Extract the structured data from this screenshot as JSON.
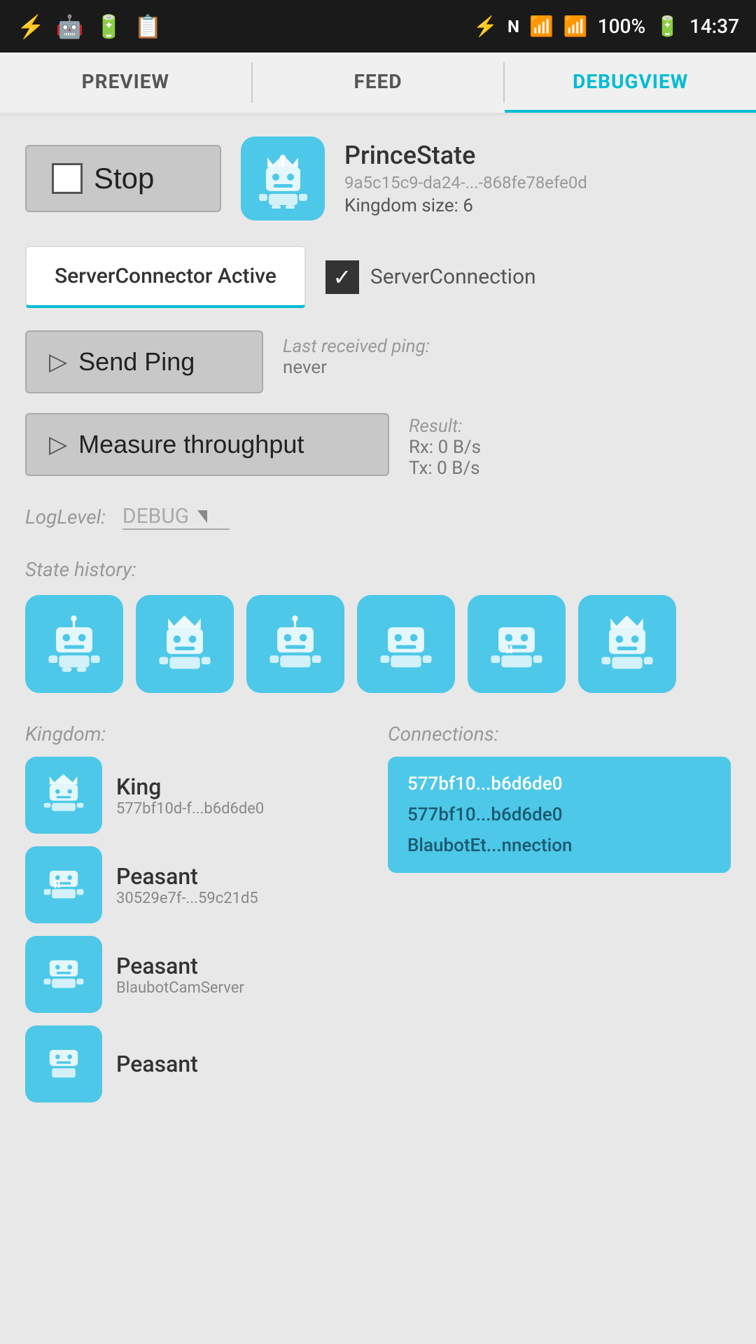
{
  "statusBar": {
    "time": "14:37",
    "battery": "100%",
    "icons": [
      "usb",
      "android",
      "battery100",
      "clipboard",
      "bluetooth",
      "nfc",
      "wifi",
      "signal"
    ]
  },
  "tabs": [
    {
      "id": "preview",
      "label": "PREVIEW",
      "active": false
    },
    {
      "id": "feed",
      "label": "FEED",
      "active": false
    },
    {
      "id": "debugview",
      "label": "DEBUGVIEW",
      "active": true
    }
  ],
  "stopButton": {
    "label": "Stop"
  },
  "princeState": {
    "name": "PrinceState",
    "id": "9a5c15c9-da24-...-868fe78efe0d",
    "kingdomSize": "Kingdom size: 6"
  },
  "serverConnector": {
    "tabLabel": "ServerConnector Active",
    "checkboxLabel": "ServerConnection"
  },
  "sendPing": {
    "label": "Send Ping",
    "lastReceivedLabel": "Last received ping:",
    "lastReceivedValue": "never"
  },
  "measureThroughput": {
    "label": "Measure throughput",
    "resultLabel": "Result:",
    "rxValue": "Rx: 0 B/s",
    "txValue": "Tx: 0 B/s"
  },
  "logLevel": {
    "label": "LogLevel:",
    "value": "DEBUG"
  },
  "stateHistory": {
    "label": "State history:",
    "count": 6
  },
  "kingdom": {
    "label": "Kingdom:",
    "items": [
      {
        "role": "King",
        "id": "577bf10d-f...b6d6de0"
      },
      {
        "role": "Peasant",
        "id": "30529e7f-...59c21d5"
      },
      {
        "role": "Peasant",
        "id": "BlaubotCamServer"
      },
      {
        "role": "Peasant",
        "id": "..."
      }
    ]
  },
  "connections": {
    "label": "Connections:",
    "items": [
      {
        "text": "577bf10...b6d6de0",
        "highlighted": true
      },
      {
        "text": "577bf10...b6d6de0",
        "highlighted": false
      },
      {
        "text": "BlaubotEt...nnection",
        "highlighted": false
      }
    ]
  }
}
